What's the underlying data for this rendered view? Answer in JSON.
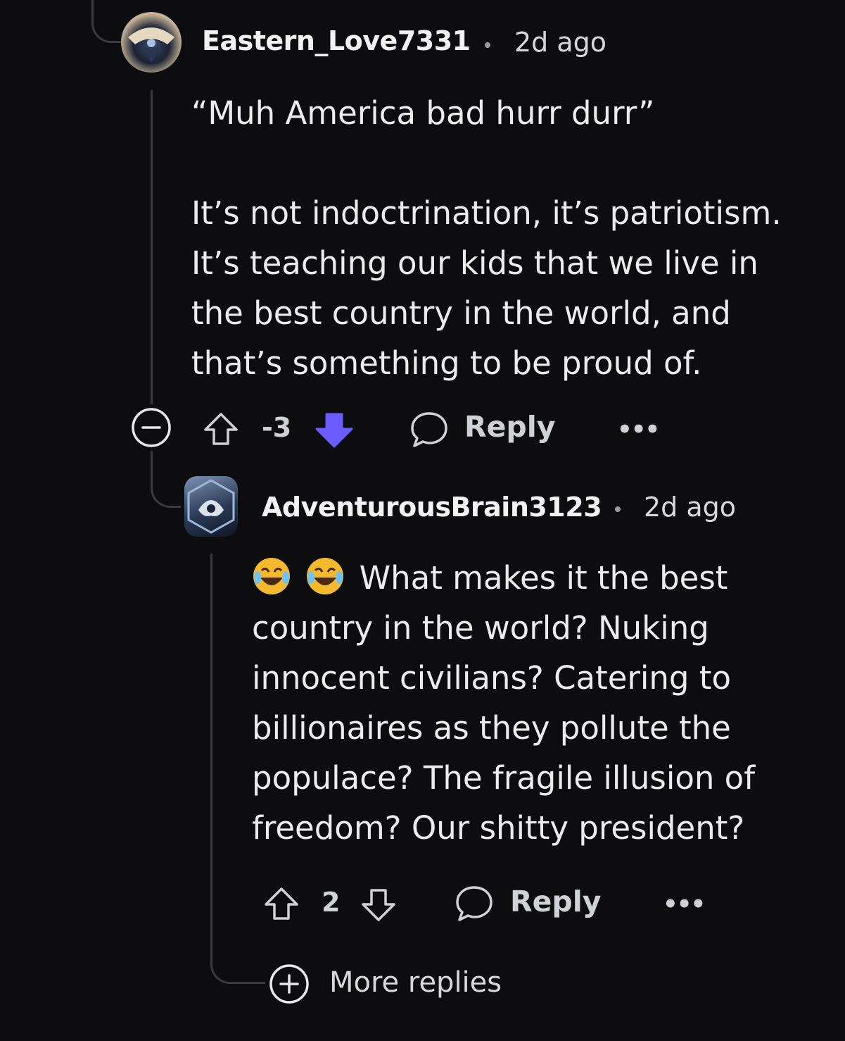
{
  "comment1": {
    "username": "Eastern_Love7331",
    "time": "2d ago",
    "lines": [
      "“Muh America bad hurr durr”",
      "",
      "It’s not indoctrination, it’s patriotism.",
      "It’s teaching our kids that we live in",
      "the best country in the world, and",
      "that’s something to be proud of."
    ],
    "score": "-3",
    "reply_label": "Reply",
    "more": "•••"
  },
  "comment2": {
    "username": "AdventurousBrain3123",
    "time": "2d ago",
    "emoji": "😂😂",
    "lines": [
      "What makes it the best",
      "country in the world? Nuking",
      "innocent civilians? Catering to",
      "billionaires as they pollute the",
      "populace? The fragile illusion of",
      "freedom? Our shitty president?"
    ],
    "score": "2",
    "reply_label": "Reply",
    "more": "•••"
  },
  "more_replies_label": "More replies",
  "colors": {
    "background": "#0d0d0f",
    "downvote_active": "#6a5cff",
    "thread_line": "#3a3b3e",
    "action_text": "#cfd1d6"
  }
}
